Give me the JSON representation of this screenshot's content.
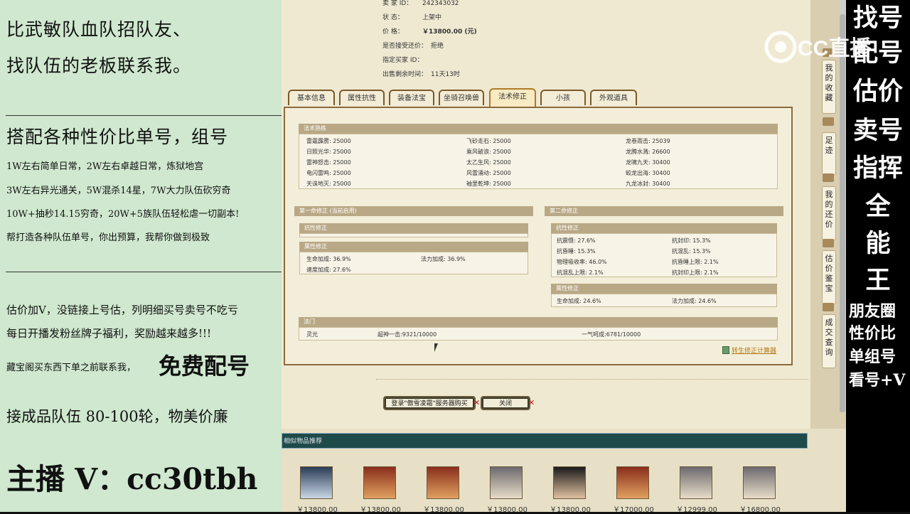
{
  "left_panel": {
    "line1": "比武敏队血队招队友、",
    "line2": "找队伍的老板联系我。",
    "line3": "搭配各种性价比单号，组号",
    "line4": "1W左右简单日常，2W左右卓越日常，炼狱地宫",
    "line5": "3W左右异光通关，5W混杀14星，7W大力队伍砍穷奇",
    "line6": "10W+抽秒14.15穷奇，20W+5族队伍轻松虐一切副本!",
    "line7": "帮打造各种队伍单号，你出预算，我帮你做到极致",
    "line8": "估价加V，没链接上号估，列明细买号卖号不吃亏",
    "line9": "每日开播发粉丝牌子福利，奖励越来越多!!!",
    "line10a": "藏宝阁买东西下单之前联系我，",
    "line10b": "免费配号",
    "line11": "接成品队伍 80-100轮，物美价廉",
    "line12": "主播 V：cc30tbh"
  },
  "info": {
    "seller_label": "卖 家  ID：",
    "seller_value": "242343032",
    "status_label": "状   态：",
    "status_value": "上架中",
    "price_label": "价   格：",
    "price_value": "￥13800.00 (元)",
    "bargain_label": "是否接受还价：",
    "bargain_value": "拒绝",
    "buyer_label": "指定买家 ID：",
    "buyer_value": "",
    "time_label": "出售剩余时间：",
    "time_value": "11天13时"
  },
  "tabs": [
    "基本信息",
    "属性抗性",
    "装备法宝",
    "坐骑召唤兽",
    "法术修正",
    "小孩",
    "外观道具"
  ],
  "active_tab": "法术修正",
  "spell_mastery": {
    "title": "法术熟练",
    "col1": [
      "雷霆霹雳: 25000",
      "日照光华: 25000",
      "雷神怒击: 25000",
      "电闪雷鸣: 25000",
      "天诛地灭: 25000"
    ],
    "col2": [
      "飞砂走石: 25000",
      "乘风破浪: 25000",
      "太乙生风: 25000",
      "风雷涌动: 25000",
      "袖里乾坤: 25000"
    ],
    "col3": [
      "龙卷雨击: 25039",
      "龙腾水溅: 26600",
      "龙啸九天: 30400",
      "蛟龙出海: 30400",
      "九龙冰封: 30400"
    ]
  },
  "first_mod": {
    "title": "第一命修正 (当前启用)",
    "resist_title": "抗性修正",
    "attr_title": "属性修正",
    "attrs": [
      "生命加成: 36.9%",
      "法力加成: 36.9%",
      "速度加成: 27.6%"
    ]
  },
  "second_mod": {
    "title": "第二命修正",
    "resist_title": "抗性修正",
    "resists": [
      "抗震慑: 27.6%",
      "抗封印: 15.3%",
      "抗昏睡: 15.3%",
      "抗混乱: 15.3%",
      "物理吸收率: 46.0%",
      "抗昏睡上限: 2.1%",
      "抗混乱上限: 2.1%",
      "抗封印上限: 2.1%"
    ],
    "attr_title": "属性修正",
    "attrs": [
      "生命加成: 24.6%",
      "法力加成: 24.6%"
    ]
  },
  "fa_men": {
    "title": "法门",
    "col1": "灵光",
    "col2": "超神一击:9321/10000",
    "col3": "一气呵成:6781/10000"
  },
  "calc_link": "转生修正计算器",
  "buttons": {
    "login_buy": "登录\"傲雪凌霜\"服务器购买",
    "close": "关闭",
    "x": "✕"
  },
  "recommend": {
    "title": "相似物品推荐",
    "prices": [
      "￥13800.00",
      "￥13800.00",
      "￥13800.00",
      "￥13800.00",
      "￥13800.00",
      "￥17000.00",
      "￥12999.00",
      "￥16800.00"
    ]
  },
  "side_buttons": [
    "我的收藏",
    "足迹",
    "我的还价",
    "估价鉴宝",
    "成交查询"
  ],
  "right_panel": {
    "r1": "找号",
    "r2": "配号",
    "r3": "估价",
    "r4": "卖号",
    "r5": "指挥",
    "r6": "全",
    "r7": "能",
    "r8": "王",
    "s1": "朋友圈",
    "s2": "性价比",
    "s3": "单组号",
    "s4": "看号+V"
  },
  "logo": "CC直播"
}
